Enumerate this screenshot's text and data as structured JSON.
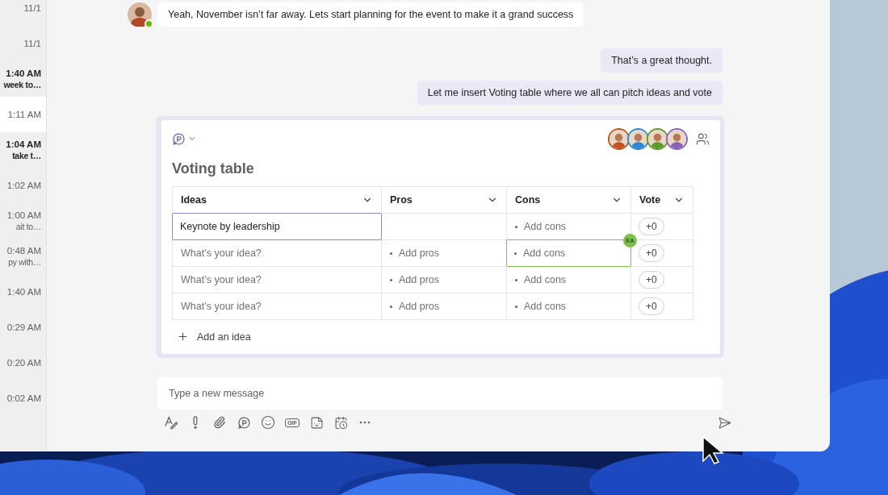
{
  "chat_list": {
    "items": [
      {
        "time": "11/1",
        "unread": false,
        "selected": false
      },
      {
        "time": "11/1",
        "unread": false,
        "selected": false
      },
      {
        "time": "1:40 AM",
        "preview": "week to…",
        "unread": true,
        "selected": false
      },
      {
        "time": "1:11 AM",
        "unread": false,
        "selected": true
      },
      {
        "time": "1:04 AM",
        "preview": "take t…",
        "unread": true,
        "selected": false
      },
      {
        "time": "1:02 AM",
        "unread": false,
        "selected": false
      },
      {
        "time": "1:00 AM",
        "preview": "ait to…",
        "unread": false,
        "selected": false
      },
      {
        "time": "0:48 AM",
        "preview": "py with…",
        "unread": false,
        "selected": false
      },
      {
        "time": "1:40 AM",
        "unread": false,
        "selected": false
      },
      {
        "time": "0:29 AM",
        "unread": false,
        "selected": false
      },
      {
        "time": "0:20 AM",
        "unread": false,
        "selected": false
      },
      {
        "time": "0:02 AM",
        "unread": false,
        "selected": false
      }
    ]
  },
  "messages": [
    {
      "kind": "received",
      "text": "Yeah, November isn’t far away. Lets start planning for the event to make it a grand success",
      "online": true
    },
    {
      "kind": "sent",
      "text": "That’s a great thought."
    },
    {
      "kind": "sent",
      "text": "Let me insert Voting table where we all can pitch ideas and vote"
    }
  ],
  "loop_card": {
    "collaborators": [
      {
        "color": "#c4541d"
      },
      {
        "color": "#2b88d8"
      },
      {
        "color": "#5b9b2b"
      },
      {
        "color": "#8764b8"
      }
    ],
    "title": "Voting table",
    "columns": [
      {
        "label": "Ideas"
      },
      {
        "label": "Pros"
      },
      {
        "label": "Cons"
      },
      {
        "label": "Vote"
      }
    ],
    "rows": [
      {
        "idea": {
          "value": "Keynote by leadership",
          "focused": true
        },
        "pros": {
          "focused": false
        },
        "cons": {
          "placeholder": "Add cons",
          "focused": false
        },
        "vote": "+0"
      },
      {
        "idea": {
          "placeholder": "What’s your idea?",
          "focused": false
        },
        "pros": {
          "placeholder": "Add pros",
          "focused": false
        },
        "cons": {
          "placeholder": "Add cons",
          "focused": true,
          "editor": {
            "initials": "EA",
            "color": "#7cbf4a"
          }
        },
        "vote": "+0"
      },
      {
        "idea": {
          "placeholder": "What’s your idea?",
          "focused": false
        },
        "pros": {
          "placeholder": "Add pros",
          "focused": false
        },
        "cons": {
          "placeholder": "Add cons",
          "focused": false
        },
        "vote": "+0"
      },
      {
        "idea": {
          "placeholder": "What’s your idea?",
          "focused": false
        },
        "pros": {
          "placeholder": "Add pros",
          "focused": false
        },
        "cons": {
          "placeholder": "Add cons",
          "focused": false
        },
        "vote": "+0"
      }
    ],
    "add_button": "Add an idea"
  },
  "compose": {
    "placeholder": "Type a new message",
    "tools": [
      {
        "kind": "format"
      },
      {
        "kind": "important"
      },
      {
        "kind": "attach"
      },
      {
        "kind": "loop"
      },
      {
        "kind": "emoji"
      },
      {
        "kind": "gif",
        "label": "GIF"
      },
      {
        "kind": "sticker"
      },
      {
        "kind": "schedule"
      },
      {
        "kind": "more"
      }
    ]
  }
}
